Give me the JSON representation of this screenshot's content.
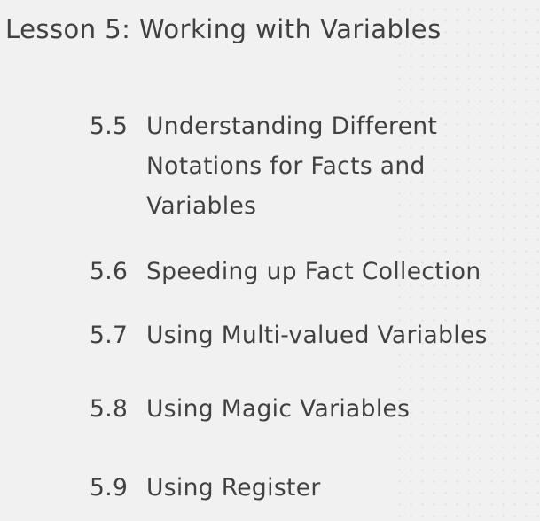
{
  "lesson": {
    "title": "Lesson 5: Working with Variables"
  },
  "toc": [
    {
      "number": "5.5",
      "lines": [
        "Understanding Different",
        "Notations for Facts and",
        "Variables"
      ]
    },
    {
      "number": "5.6",
      "lines": [
        "Speeding up Fact Collection"
      ]
    },
    {
      "number": "5.7",
      "lines": [
        "Using Multi-valued Variables"
      ]
    },
    {
      "number": "5.8",
      "lines": [
        "Using Magic Variables"
      ]
    },
    {
      "number": "5.9",
      "lines": [
        "Using Register"
      ]
    }
  ]
}
